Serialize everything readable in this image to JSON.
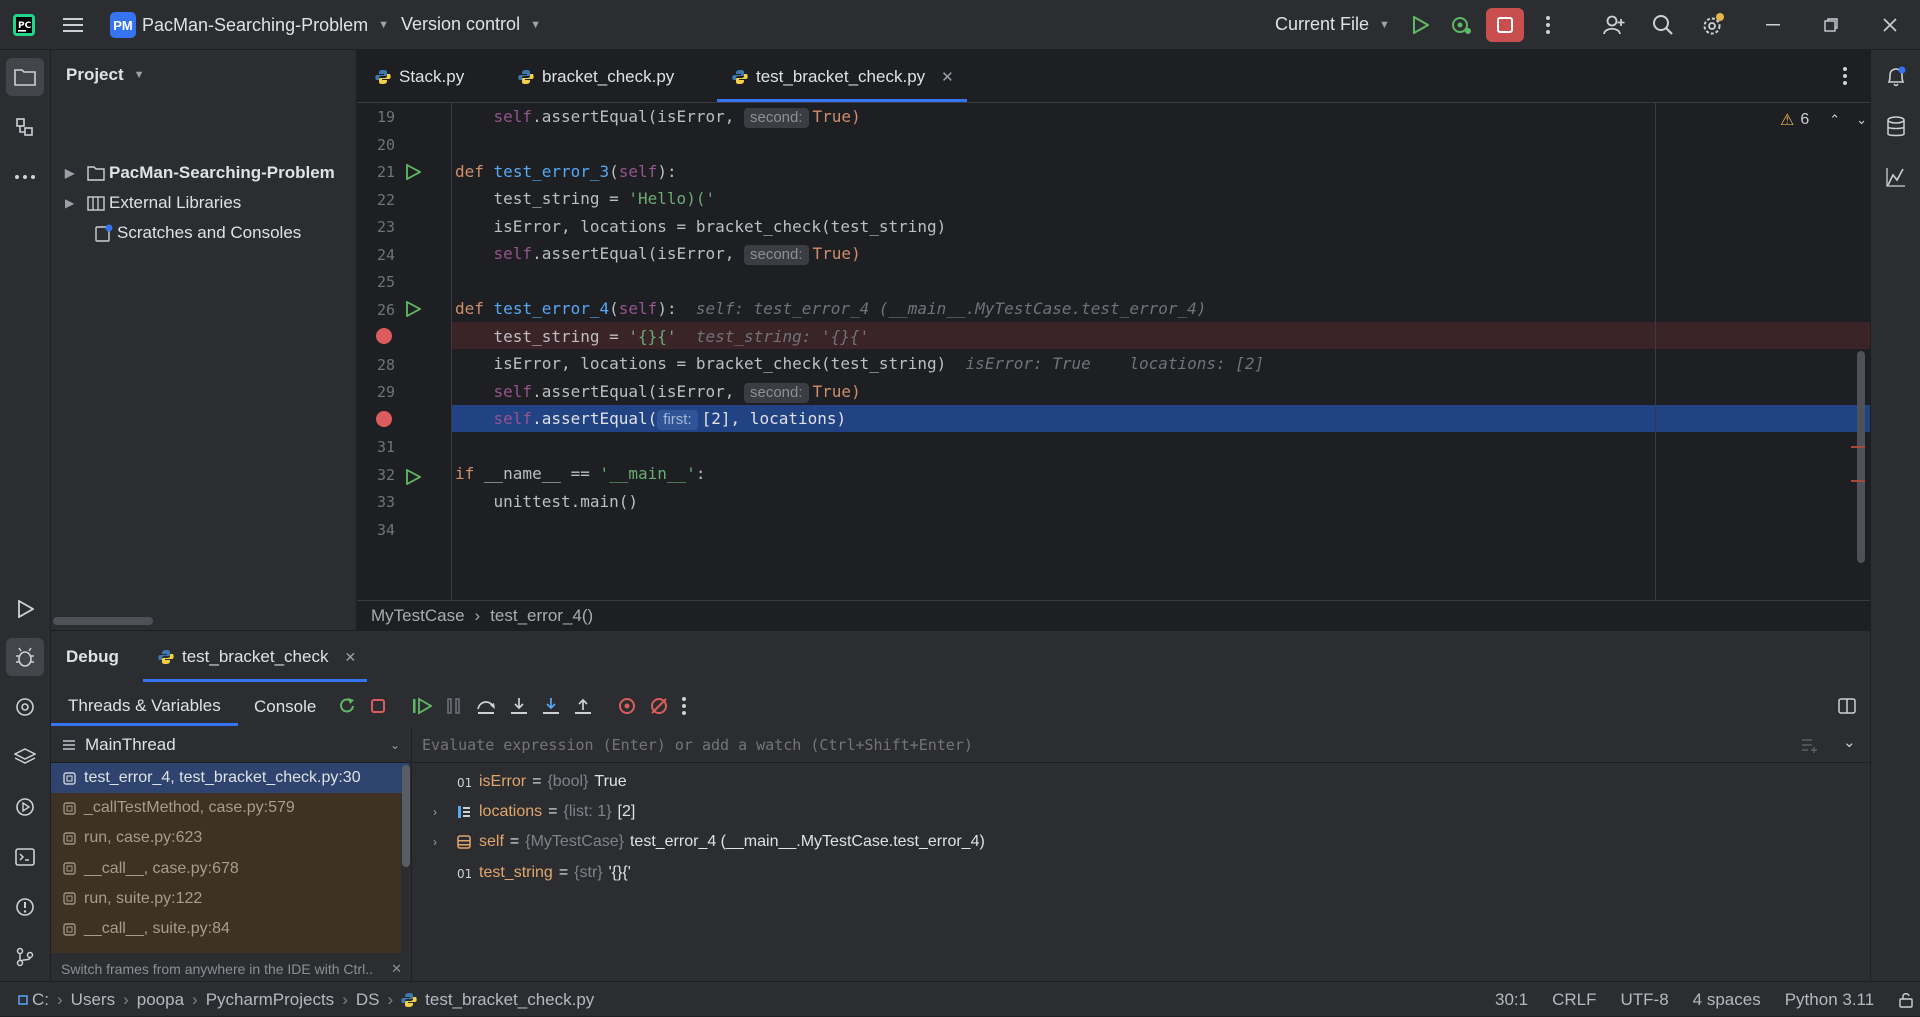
{
  "titlebar": {
    "project_badge": "PM",
    "project_name": "PacMan-Searching-Problem",
    "vcs": "Version control",
    "run_config": "Current File"
  },
  "project_panel": {
    "title": "Project",
    "items": [
      {
        "label": "PacMan-Searching-Problem"
      },
      {
        "label": "External Libraries"
      },
      {
        "label": "Scratches and Consoles"
      }
    ]
  },
  "tabs": [
    {
      "label": "Stack.py"
    },
    {
      "label": "bracket_check.py"
    },
    {
      "label": "test_bracket_check.py"
    }
  ],
  "editor": {
    "warnings_count": "6",
    "line_numbers": [
      "19",
      "20",
      "21",
      "22",
      "23",
      "24",
      "25",
      "26",
      "",
      "28",
      "29",
      "",
      "31",
      "32",
      "33",
      "34"
    ],
    "code": {
      "l19_hint": "second:",
      "l19_tail": "True)",
      "l21_def": "def",
      "l21_name": "test_error_3",
      "l21_self": "self",
      "l22_lhs": "test_string = ",
      "l22_str": "'Hello)('",
      "l23": "isError, locations = bracket_check(test_string)",
      "l24_hint": "second:",
      "l24_tail": "True)",
      "l26_def": "def",
      "l26_name": "test_error_4",
      "l26_self": "self",
      "l26_inline": "self: test_error_4 (__main__.MyTestCase.test_error_4)",
      "l27_lhs": "test_string = ",
      "l27_str": "'{}{'",
      "l27_inline": "test_string: '{}{'",
      "l28": "isError, locations = bracket_check(test_string)",
      "l28_inline1": "isError: True",
      "l28_inline2": "locations: [2]",
      "l29_hint": "second:",
      "l29_tail": "True)",
      "l30_hint": "first:",
      "l30_tail": "[2], locations)",
      "l32_if": "if",
      "l32_mid": " __name__ == ",
      "l32_str": "'__main__'",
      "l32_tail": ":",
      "l33": "unittest.main()",
      "assert_prefix": "self",
      "assert_call": ".assertEqual(isError, ",
      "assert_call_open": ".assertEqual("
    }
  },
  "breadcrumb": {
    "class": "MyTestCase",
    "sep": "›",
    "method": "test_error_4()"
  },
  "debug": {
    "title": "Debug",
    "session_tab": "test_bracket_check",
    "subtabs": [
      "Threads & Variables",
      "Console"
    ],
    "thread": "MainThread",
    "evaluate_placeholder": "Evaluate expression (Enter) or add a watch (Ctrl+Shift+Enter)",
    "frames": [
      "test_error_4, test_bracket_check.py:30",
      "_callTestMethod, case.py:579",
      "run, case.py:623",
      "__call__, case.py:678",
      "run, suite.py:122",
      "__call__, suite.py:84"
    ],
    "frames_hint": "Switch frames from anywhere in the IDE with Ctrl..",
    "variables": [
      {
        "name": "isError",
        "eq": "=",
        "type": "{bool}",
        "value": "True"
      },
      {
        "name": "locations",
        "eq": "=",
        "type": "{list: 1}",
        "value": "[2]"
      },
      {
        "name": "self",
        "eq": "=",
        "type": "{MyTestCase}",
        "value": "test_error_4 (__main__.MyTestCase.test_error_4)"
      },
      {
        "name": "test_string",
        "eq": "=",
        "type": "{str}",
        "value": "'{}{'"
      }
    ]
  },
  "status": {
    "path": [
      "C:",
      "Users",
      "poopa",
      "PycharmProjects",
      "DS",
      "test_bracket_check.py"
    ],
    "position": "30:1",
    "line_sep": "CRLF",
    "encoding": "UTF-8",
    "indent": "4 spaces",
    "interpreter": "Python 3.11"
  },
  "colors": {
    "accent": "#3574f0",
    "breakpoint": "#db5c5c",
    "stop": "#db5c5c",
    "run": "#5fb865"
  }
}
